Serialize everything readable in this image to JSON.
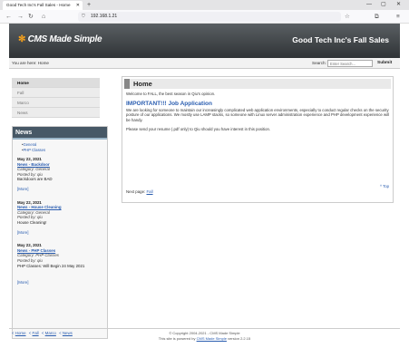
{
  "browser": {
    "tab_title": "Good Tech Inc's Fall Sales - Home",
    "url": "192.168.1.21",
    "tab_close": "✕",
    "new_tab": "+",
    "win_min": "—",
    "win_max": "▢",
    "win_close": "✕",
    "back": "←",
    "forward": "→",
    "reload": "↻",
    "shield": "⛉",
    "lock": "🔒",
    "bookmark": "☆",
    "extensions": "⧉",
    "menu": "≡"
  },
  "header": {
    "logo_text": "CMS Made Simple",
    "logo_mark": "✻",
    "site_name": "Good Tech Inc's Fall Sales"
  },
  "crumbs": {
    "prefix": "You are here:",
    "current": "Home"
  },
  "search": {
    "label": "Search:",
    "placeholder": "Enter Search...",
    "submit": "Submit"
  },
  "menu": {
    "items": [
      "Home",
      "Fall",
      "Marco",
      "News"
    ]
  },
  "news": {
    "heading": "News",
    "categories": [
      "General",
      "PHP Classes"
    ],
    "items": [
      {
        "date": "May 22, 2021",
        "title": "News - Backdoor",
        "category": "Category: General",
        "posted": "Posted by: qiu",
        "summary": "Backdoors are BAD",
        "more": "[More]"
      },
      {
        "date": "May 22, 2021",
        "title": "News - House Cleaning",
        "category": "Category: General",
        "posted": "Posted by: qiu",
        "summary": "House Cleaning!",
        "more": "[More]"
      },
      {
        "date": "May 22, 2021",
        "title": "News - PHP Classes",
        "category": "Category: PHP Classes",
        "posted": "Posted by: qiu",
        "summary": "PHP Classes: Will Begin 24 May 2021",
        "more": "[More]"
      }
    ]
  },
  "content": {
    "title": "Home",
    "intro": "Welcome to FALL, the best season in Qiu's opinion.",
    "heading": "IMPORTANT!!! Job Application",
    "para1": "We are looking for someone to maintain our increasingly complicated web application environments, especially to conduct regular checks on the security posture of our applications. We mostly use LAMP stacks, so someone with Linux server administration experience and PHP development experience will be handy.",
    "para2": "Please send your resume (.pdf only) to Qiu should you have interest in this position.",
    "next_label": "Next page:",
    "next_link": "Fall",
    "top_link": "^ Top"
  },
  "footer": {
    "links": [
      "Home",
      "Fall",
      "Marco",
      "News"
    ],
    "copyright": "© Copyright 2004-2021 - CMS Made Simple",
    "powered_prefix": "This site is powered by",
    "powered_link": "CMS Made Simple",
    "powered_suffix": "version 2.2.15"
  }
}
